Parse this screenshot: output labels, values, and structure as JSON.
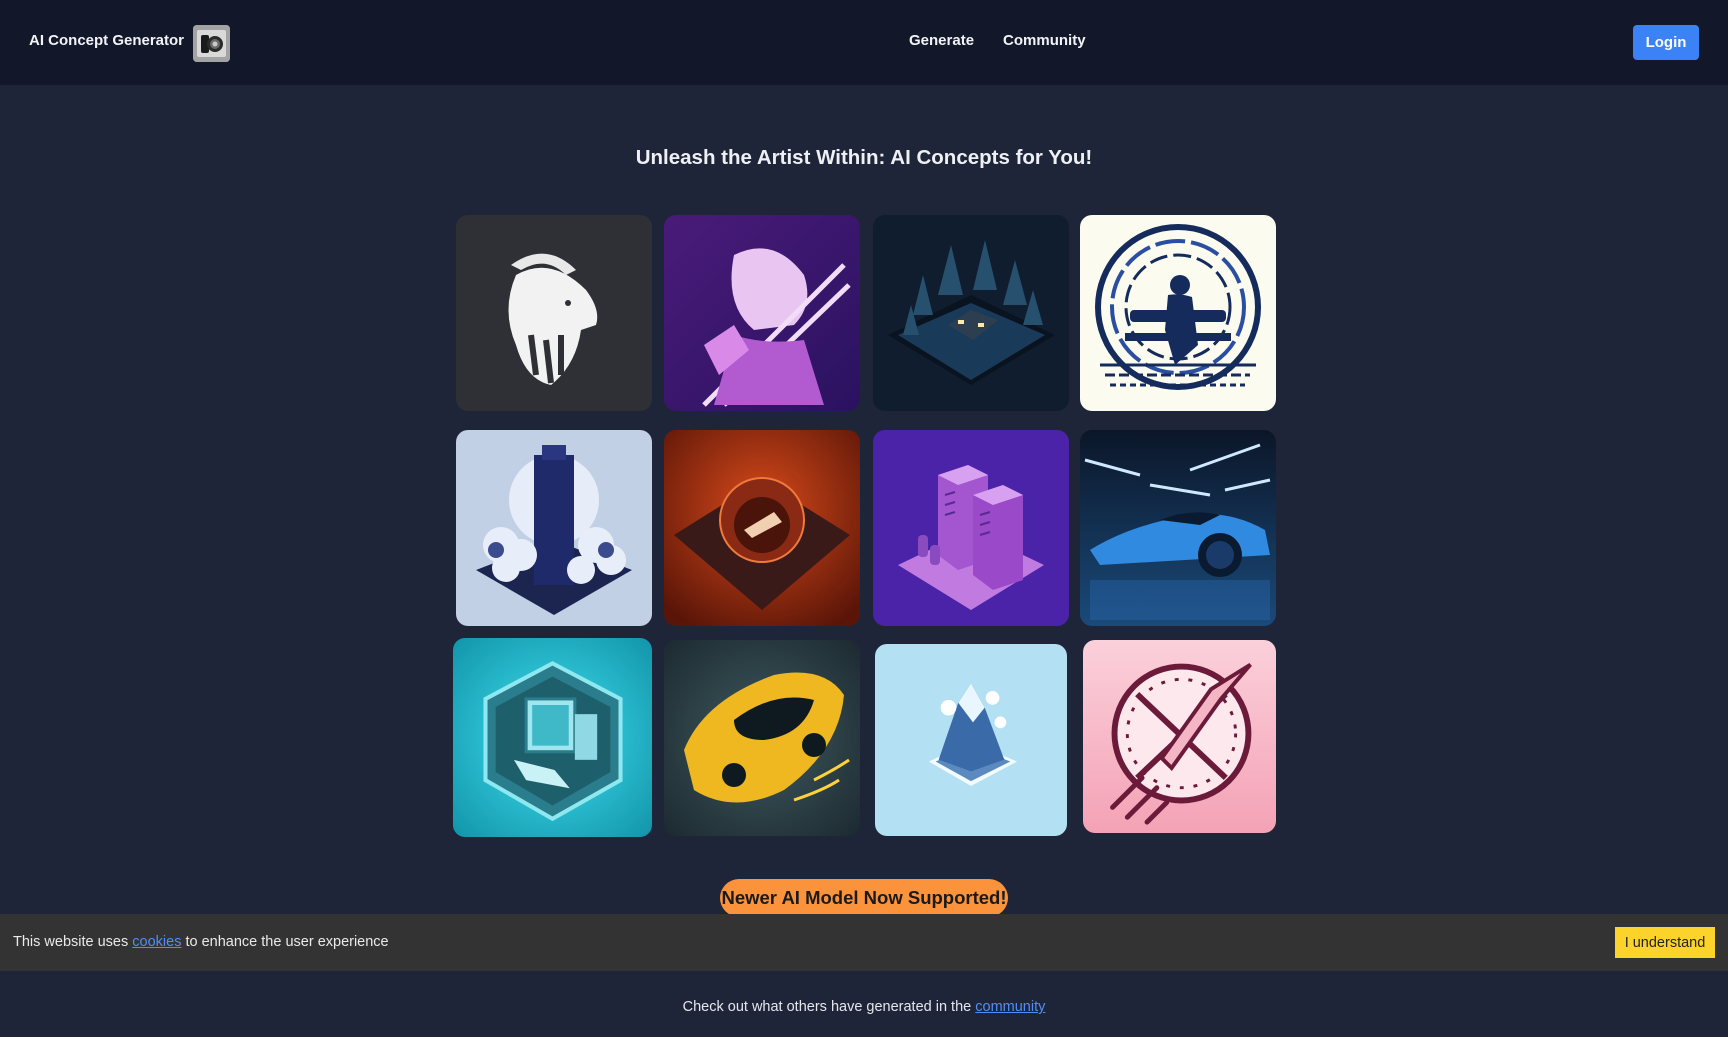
{
  "header": {
    "brand": "AI Concept Generator",
    "brand_icon": "camera-logo-icon",
    "nav": [
      {
        "label": "Generate"
      },
      {
        "label": "Community"
      }
    ],
    "login_label": "Login",
    "accent_color": "#3b82f6"
  },
  "main": {
    "headline": "Unleash the Artist Within: AI Concepts for You!",
    "gallery": [
      {
        "subject": "white goat head logo",
        "bg": "#2f2f36"
      },
      {
        "subject": "anime swordsman purple line art",
        "bg": "#3a1a6a"
      },
      {
        "subject": "isometric dark forest cabin",
        "bg": "#0f1d2e"
      },
      {
        "subject": "man on bench blue circular maze",
        "bg": "#fbfbef"
      },
      {
        "subject": "isometric skyscraper in clouds",
        "bg": "#c2d0e6"
      },
      {
        "subject": "isometric red planet spaceship",
        "bg": "#8a2a14"
      },
      {
        "subject": "isometric purple server racks",
        "bg": "#4b23a8"
      },
      {
        "subject": "blue sports car in garage",
        "bg": "#0d1f3a"
      },
      {
        "subject": "isometric teal retro computer",
        "bg": "#17b9c9"
      },
      {
        "subject": "yellow stylized supercar",
        "bg": "#2e3f45"
      },
      {
        "subject": "isometric ice mountain",
        "bg": "#b3e0f2"
      },
      {
        "subject": "pink rocket emblem",
        "bg": "#f6b5c3"
      }
    ],
    "announcement": "Newer AI Model Now Supported!",
    "announcement_color": "#fb923c"
  },
  "cookie": {
    "text_before": "This website uses ",
    "link": "cookies",
    "text_after": " to enhance the user experience",
    "button": "I understand",
    "button_color": "#fcd32a"
  },
  "footer": {
    "text": "Check out what others have generated in the ",
    "link": "community"
  }
}
